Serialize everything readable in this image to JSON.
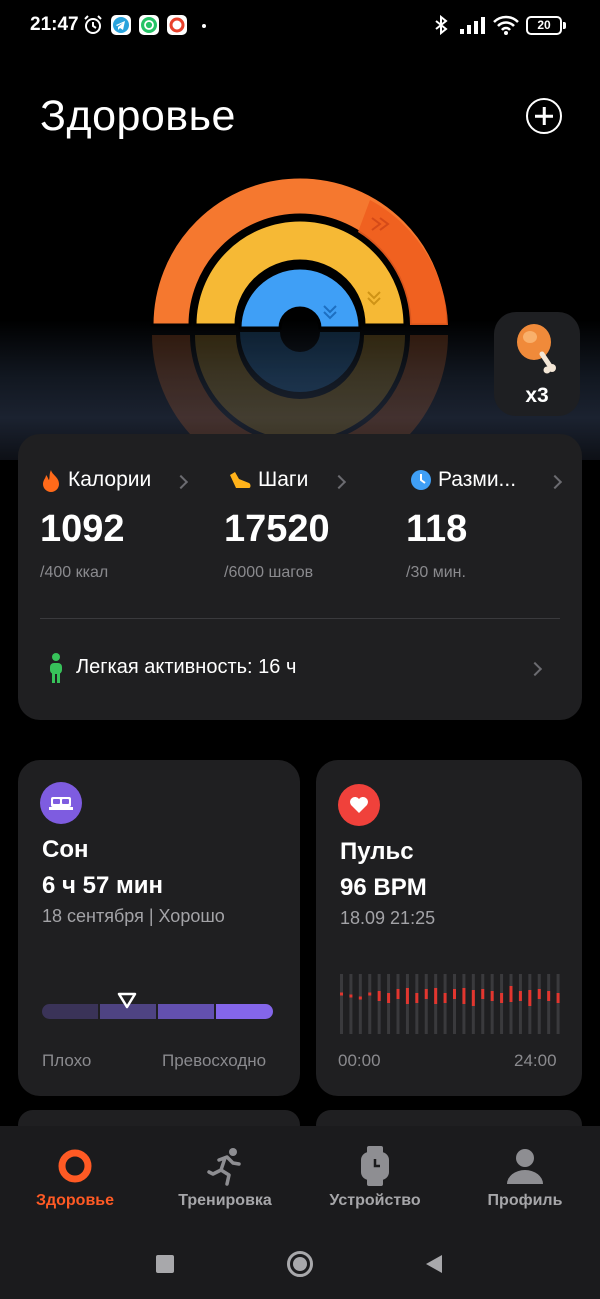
{
  "status_bar": {
    "time": "21:47",
    "battery": "20",
    "icons": [
      "alarm-icon",
      "telegram-icon",
      "whatsapp-icon",
      "screen-record-icon",
      "bluetooth-icon",
      "signal-icon",
      "wifi-icon",
      "battery-icon"
    ]
  },
  "header": {
    "title": "Здоровье",
    "add_icon": "plus-circle-icon"
  },
  "rings": {
    "colors": {
      "outer": "#f5782f",
      "middle": "#f6b935",
      "inner": "#3f9ff6"
    }
  },
  "reward": {
    "icon": "drumstick-icon",
    "count": "x3"
  },
  "stats": {
    "calories": {
      "label": "Калории",
      "value": "1092",
      "goal": "/400 ккал",
      "color": "#ff6a1a"
    },
    "steps": {
      "label": "Шаги",
      "value": "17520",
      "goal": "/6000 шагов",
      "color": "#ffb21a"
    },
    "movement": {
      "label": "Разми...",
      "value": "118",
      "goal": "/30 мин.",
      "color": "#3f9ff6"
    },
    "activity": "Легкая активность: 16 ч"
  },
  "sleep": {
    "title": "Сон",
    "value": "6 ч 57 мин",
    "subtitle": "18 сентября | Хорошо",
    "low_label": "Плохо",
    "high_label": "Превосходно",
    "quality": 0.37
  },
  "pulse": {
    "title": "Пульс",
    "value": "96 BPM",
    "subtitle": "18.09 21:25",
    "start": "00:00",
    "end": "24:00"
  },
  "nav": {
    "items": [
      {
        "label": "Здоровье",
        "icon": "health-ring-icon"
      },
      {
        "label": "Тренировка",
        "icon": "running-icon"
      },
      {
        "label": "Устройство",
        "icon": "watch-icon"
      },
      {
        "label": "Профиль",
        "icon": "profile-icon"
      }
    ]
  },
  "system_nav": [
    "recents-button",
    "home-button",
    "back-button"
  ]
}
